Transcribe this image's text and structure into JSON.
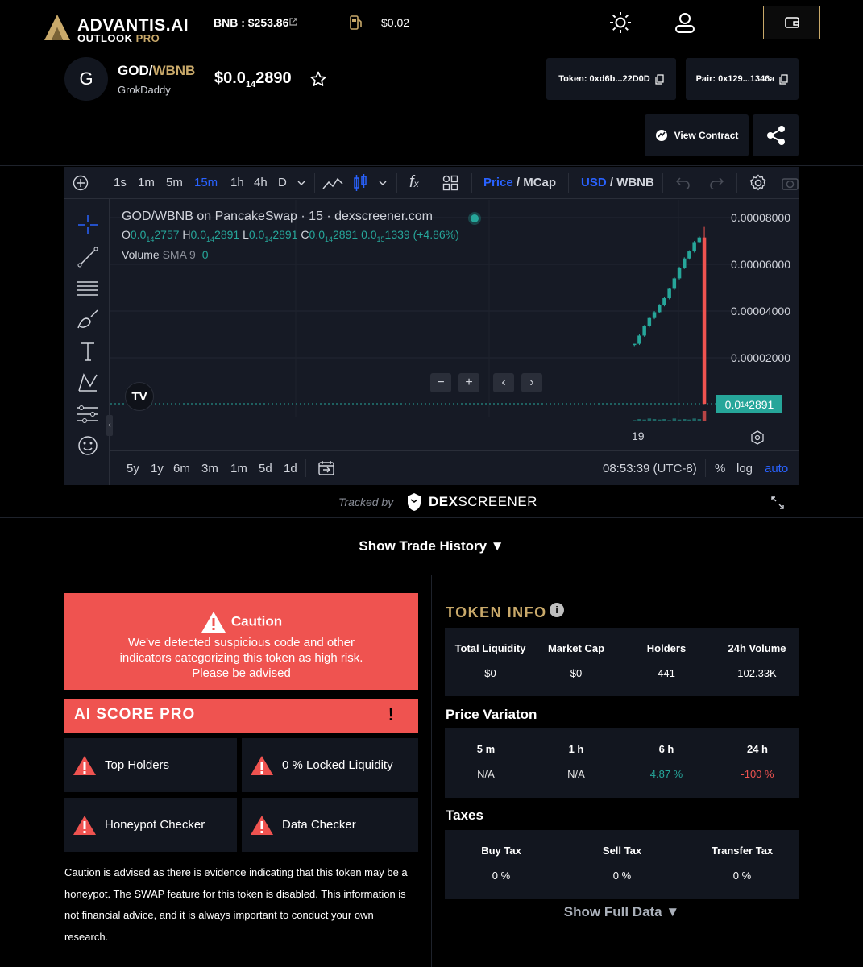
{
  "header": {
    "brand": "ADVANTIS.AI",
    "brand_sub_a": "OUTLOOK",
    "brand_sub_b": "PRO",
    "bnb_price": "BNB : $253.86",
    "gas_price": "$0.02"
  },
  "token": {
    "avatar_letter": "G",
    "base": "GOD/",
    "quote": "WBNB",
    "name": "GrokDaddy",
    "price_prefix": "$0.0",
    "price_zeros": "14",
    "price_suffix": "2890",
    "token_chip": "Token: 0xd6b...22D0D",
    "pair_chip": "Pair: 0x129...1346a",
    "view_contract": "View Contract"
  },
  "chart": {
    "toolbar": {
      "intervals": [
        "1s",
        "1m",
        "5m",
        "15m",
        "1h",
        "4h",
        "D"
      ],
      "active_interval": "15m",
      "price_label": "Price",
      "mcap_label": "MCap",
      "usd_label": "USD",
      "wbnb_label": "WBNB"
    },
    "legend_title": "GOD/WBNB on PancakeSwap · 15 · dexscreener.com",
    "ohlc": {
      "o_label": "O",
      "o_a": "0.0",
      "o_sub": "14",
      "o_b": "2757",
      "h_label": "H",
      "h_a": "0.0",
      "h_sub": "14",
      "h_b": "2891",
      "l_label": "L",
      "l_a": "0.0",
      "l_sub": "14",
      "l_b": "2891",
      "c_label": "C",
      "c_a": "0.0",
      "c_sub": "14",
      "c_b": "2891",
      "chg_a": "0.0",
      "chg_sub": "15",
      "chg_b": "1339",
      "chg_pct": "(+4.86%)"
    },
    "volume_label": "Volume",
    "sma_label": "SMA 9",
    "volume_value": "0",
    "y_ticks": [
      "0.00008000",
      "0.00006000",
      "0.00004000",
      "0.00002000"
    ],
    "last_price_a": "0.0",
    "last_price_sub": "14",
    "last_price_b": "2891",
    "x_tick": "19",
    "ranges": [
      "5y",
      "1y",
      "6m",
      "3m",
      "1m",
      "5d",
      "1d"
    ],
    "clock": "08:53:39 (UTC-8)",
    "pct": "%",
    "log": "log",
    "auto": "auto"
  },
  "chart_data": {
    "type": "candlestick",
    "title": "GOD/WBNB on PancakeSwap · 15 · dexscreener.com",
    "ylim": [
      0,
      9e-05
    ],
    "y_ticks": [
      2e-05,
      4e-05,
      6e-05,
      8e-05
    ],
    "x_tick_labels": [
      "19"
    ],
    "candles": [
      {
        "o": 2.55e-05,
        "h": 2.6e-05,
        "l": 2.5e-05,
        "c": 2.6e-05
      },
      {
        "o": 2.6e-05,
        "h": 3e-05,
        "l": 2.55e-05,
        "c": 2.95e-05
      },
      {
        "o": 2.95e-05,
        "h": 3.4e-05,
        "l": 2.9e-05,
        "c": 3.35e-05
      },
      {
        "o": 3.35e-05,
        "h": 3.75e-05,
        "l": 3.3e-05,
        "c": 3.7e-05
      },
      {
        "o": 3.7e-05,
        "h": 4e-05,
        "l": 3.65e-05,
        "c": 3.95e-05
      },
      {
        "o": 3.95e-05,
        "h": 4.3e-05,
        "l": 3.9e-05,
        "c": 4.25e-05
      },
      {
        "o": 4.25e-05,
        "h": 4.6e-05,
        "l": 4.2e-05,
        "c": 4.55e-05
      },
      {
        "o": 4.55e-05,
        "h": 5e-05,
        "l": 4.5e-05,
        "c": 4.95e-05
      },
      {
        "o": 4.95e-05,
        "h": 5.45e-05,
        "l": 4.9e-05,
        "c": 5.4e-05
      },
      {
        "o": 5.4e-05,
        "h": 5.9e-05,
        "l": 5.35e-05,
        "c": 5.85e-05
      },
      {
        "o": 5.85e-05,
        "h": 6.3e-05,
        "l": 5.8e-05,
        "c": 6.25e-05
      },
      {
        "o": 6.25e-05,
        "h": 6.6e-05,
        "l": 6.2e-05,
        "c": 6.55e-05
      },
      {
        "o": 6.55e-05,
        "h": 7e-05,
        "l": 6.5e-05,
        "c": 6.95e-05
      },
      {
        "o": 6.95e-05,
        "h": 7.2e-05,
        "l": 6.9e-05,
        "c": 7.15e-05
      },
      {
        "o": 7.15e-05,
        "h": 7.6e-05,
        "l": 2e-07,
        "c": 3e-07
      }
    ],
    "volumes": [
      1,
      3,
      2,
      4,
      3,
      2,
      3,
      1,
      4,
      2,
      3,
      2,
      4,
      3,
      18
    ]
  },
  "tracked": {
    "prefix": "Tracked by",
    "brand_a": "DEX",
    "brand_b": "SCREENER"
  },
  "trade_history": "Show Trade History ▼",
  "caution": {
    "title": "Caution",
    "desc": "We've detected suspicious code and other indicators categorizing this token as high risk. Please be advised"
  },
  "ai_score": {
    "title": "AI SCORE PRO",
    "mark": "!"
  },
  "checks": [
    "Top Holders",
    "0 % Locked Liquidity",
    "Honeypot Checker",
    "Data Checker"
  ],
  "note": "Caution is advised as there is evidence indicating that this token may be a honeypot. The SWAP feature for this token is disabled. This information is not financial advice, and it is always important to conduct your own research.",
  "token_info": {
    "title": "TOKEN INFO",
    "headers": [
      "Total Liquidity",
      "Market Cap",
      "Holders",
      "24h Volume"
    ],
    "values": [
      "$0",
      "$0",
      "441",
      "102.33K"
    ]
  },
  "price_variation": {
    "title": "Price Variaton",
    "headers": [
      "5 m",
      "1 h",
      "6 h",
      "24 h"
    ],
    "values": [
      "N/A",
      "N/A",
      "4.87 %",
      "-100 %"
    ],
    "colors": [
      "#e6e6e6",
      "#e6e6e6",
      "#26a69a",
      "#ef5350"
    ]
  },
  "taxes": {
    "title": "Taxes",
    "headers": [
      "Buy Tax",
      "Sell Tax",
      "Transfer Tax"
    ],
    "values": [
      "0 %",
      "0 %",
      "0 %"
    ]
  },
  "show_full": "Show Full Data ▼"
}
